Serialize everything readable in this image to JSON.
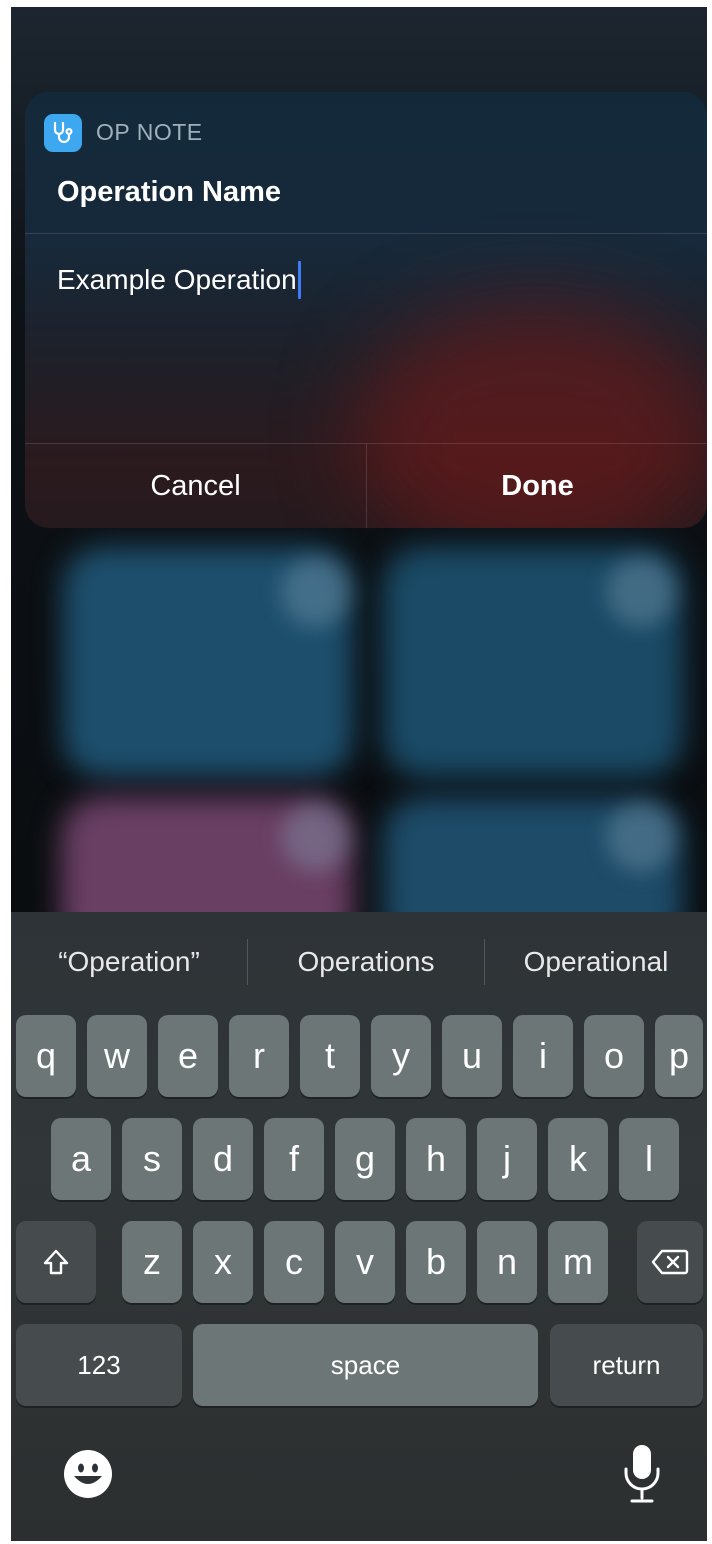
{
  "dialog": {
    "app_name": "OP NOTE",
    "title": "Operation Name",
    "field_value": "Example Operation",
    "cancel_label": "Cancel",
    "done_label": "Done"
  },
  "keyboard": {
    "suggestions": [
      "“Operation”",
      "Operations",
      "Operational"
    ],
    "row1": [
      "q",
      "w",
      "e",
      "r",
      "t",
      "y",
      "u",
      "i",
      "o",
      "p"
    ],
    "row2": [
      "a",
      "s",
      "d",
      "f",
      "g",
      "h",
      "j",
      "k",
      "l"
    ],
    "row3": [
      "z",
      "x",
      "c",
      "v",
      "b",
      "n",
      "m"
    ],
    "numbers_label": "123",
    "space_label": "space",
    "return_label": "return"
  },
  "icons": {
    "app": "stethoscope-icon",
    "shift": "shift-arrow-icon",
    "delete": "backspace-icon",
    "emoji": "emoji-smiley-icon",
    "dictation": "microphone-icon"
  },
  "colors": {
    "accent": "#3da8f0",
    "caret": "#3e7cf6",
    "key": "#6c7676",
    "key_dark": "#464c4e"
  }
}
